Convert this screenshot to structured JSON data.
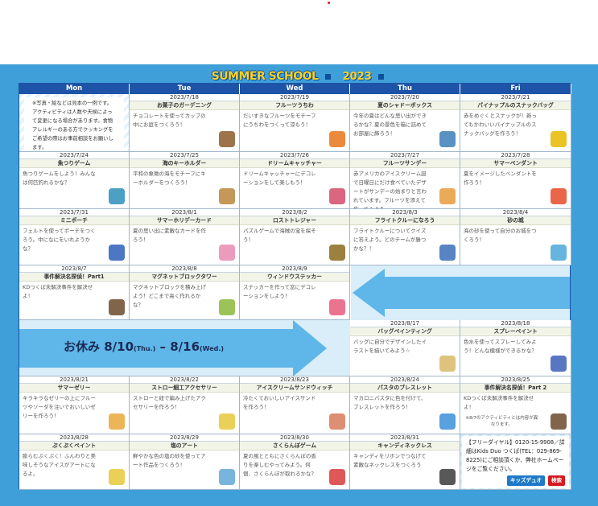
{
  "header": {
    "title": "SUMMER SCHOOL",
    "year": "2023"
  },
  "days": [
    "Mon",
    "Tue",
    "Wed",
    "Thu",
    "Fri"
  ],
  "mon_note": "※写真・絵などは見本の一例です。アクティビティは人数や天候によって変更になる場合があります。食物アレルギーのある方でクッキングをご希望の際はお事前相談をお願いします。",
  "weeks": [
    {
      "cells": [
        null,
        {
          "date": "2023/7/18",
          "title": "お菓子のガーデニング",
          "desc": "チョコレートを使ってカップの中にお庭をつくろう！",
          "icon": "cup-icon",
          "color": "#8b5a2b"
        },
        {
          "date": "2023/7/19",
          "title": "フルーツうちわ",
          "desc": "だいすきなフルーツをモチーフにうちわをつくって涼もう！",
          "icon": "fan-icon",
          "color": "#e8761a"
        },
        {
          "date": "2023/7/20",
          "title": "夏のシャドーボックス",
          "desc": "今年の夏はどんな思い出ができるかな？夏の景色を箱に詰めてお部屋に飾ろう！",
          "icon": "box-icon",
          "color": "#3b7fb8"
        },
        {
          "date": "2023/7/21",
          "title": "パイナップルのスナックバッグ",
          "desc": "赤をめぐくとスナックが！新ってもかわいいパイナップルのスナックバッグを作ろう！",
          "icon": "pineapple-icon",
          "color": "#e6b800"
        }
      ]
    },
    {
      "cells": [
        {
          "date": "2023/7/24",
          "title": "魚つりゲーム",
          "desc": "魚つりゲームをしよう！みんなは何匹釣れるかな？",
          "icon": "fish-icon",
          "color": "#2b8fb8"
        },
        {
          "date": "2023/7/25",
          "title": "海のキーホルダー",
          "desc": "平和の象徴の海をモチーフにキーホルダーをつくろう！",
          "icon": "keyholder-icon",
          "color": "#b8863b"
        },
        {
          "date": "2023/7/26",
          "title": "ドリームキャッチャー",
          "desc": "ドリームキャッチャーにデコレーションをして楽しもう！",
          "icon": "dreamcatcher-icon",
          "color": "#d44b6a"
        },
        {
          "date": "2023/7/27",
          "title": "フルーツサンデー",
          "desc": "赤アメリカのアイスクリーム誕で日曜日にだけ食べていたデザートがサンデーの始まりと言われています。フルーツを添えて作ってみよう。",
          "icon": "sundae-icon",
          "color": "#e89b3b"
        },
        {
          "date": "2023/7/28",
          "title": "サマーペンダント",
          "desc": "夏をイメージしたペンダントを作ろう！",
          "icon": "pendant-icon",
          "color": "#e84a2b"
        }
      ]
    },
    {
      "cells": [
        {
          "date": "2023/7/31",
          "title": "ミニポーチ",
          "desc": "フェルトを使ってポーチをつくろう。中になにをいれようかな？",
          "icon": "pouch-icon",
          "color": "#2b5fb8"
        },
        {
          "date": "2023/8/1",
          "title": "サマーホリデーカード",
          "desc": "夏の思い出に素敵なカードを作ろう！",
          "icon": "card-icon",
          "color": "#e88bb0"
        },
        {
          "date": "2023/8/2",
          "title": "ロストトレジャー",
          "desc": "パズルゲームで海賊の宝を探そう！",
          "icon": "treasure-icon",
          "color": "#8b6a1b"
        },
        {
          "date": "2023/8/3",
          "title": "フライトクルーになろう",
          "desc": "フライトクルーについてクイズに答えよう。どのチームが勝つかな？！",
          "icon": "crew-icon",
          "color": "#3b6fb8"
        },
        {
          "date": "2023/8/4",
          "title": "砂の城",
          "desc": "海の砂を使って自分のお城をつくろう！",
          "icon": "castle-icon",
          "color": "#4ba8d8"
        }
      ]
    },
    {
      "cells": [
        {
          "date": "2023/8/7",
          "title": "事件解決名探偵！Part1",
          "desc": "KDつくば未解決事件を解決せよ！",
          "icon": "detective-icon",
          "color": "#6b4a2b"
        },
        {
          "date": "2023/8/8",
          "title": "マグネットブロックタワー",
          "desc": "マグネットブロックを積み上げよう！どこまで高く作れるかな？",
          "icon": "block-icon",
          "color": "#8bb83b"
        },
        {
          "date": "2023/8/9",
          "title": "ウィンドウステッカー",
          "desc": "ステッカーを作って窓にデコレーションをしよう！",
          "icon": "sticker-icon",
          "color": "#e85a7a"
        },
        null,
        null
      ]
    },
    {
      "cells": [
        null,
        null,
        null,
        {
          "date": "2023/8/17",
          "title": "バッグペインティング",
          "desc": "バッグに自分でデザインしたイラストを描いてみよう☆",
          "icon": "bag-icon",
          "color": "#d8b86a"
        },
        {
          "date": "2023/8/18",
          "title": "スプレーペイント",
          "desc": "色水を使ってスプレーしてみよう！どんな模様ができるかな？",
          "icon": "spray-icon",
          "color": "#3b5fb8"
        }
      ]
    },
    {
      "cells": [
        {
          "date": "2023/8/21",
          "title": "サマーゼリー",
          "desc": "キラキラなゼリーの上にフルーツやソーダを注いでおいしいゼリーを作ろう！",
          "icon": "jelly-icon",
          "color": "#e8a83b"
        },
        {
          "date": "2023/8/22",
          "title": "ストロー細工アクセサリー",
          "desc": "ストローと紐で編み上げたアクセサリーを作ろう！",
          "icon": "straw-icon",
          "color": "#e8c83b"
        },
        {
          "date": "2023/8/23",
          "title": "アイスクリームサンドウィッチ",
          "desc": "冷たくておいしいアイスサンドを作ろう！",
          "icon": "icecream-icon",
          "color": "#d87a5a"
        },
        {
          "date": "2023/8/24",
          "title": "パスタのブレスレット",
          "desc": "マカロニパスタに色を付けて、ブレスレットを作ろう！",
          "icon": "bracelet-icon",
          "color": "#3b8fd8"
        },
        {
          "date": "2023/8/25",
          "title": "事件解決名探偵！Part 2",
          "desc": "KDつくば未解決事件を解決せよ！",
          "note": "※8/7のアクティビティとは内容が異なります。",
          "icon": "detective-icon",
          "color": "#6b4a2b"
        }
      ]
    },
    {
      "cells": [
        {
          "date": "2023/8/28",
          "title": "ぷくぷくペイント",
          "desc": "膨らむぷくぷく！ふんわりと美味しそうなアイスがアートになるよ。",
          "icon": "paint-icon",
          "color": "#e8c83b"
        },
        {
          "date": "2023/8/29",
          "title": "塩のアート",
          "desc": "鮮やかな色の塩の砂を使ってアート作品をつくろう！",
          "icon": "salt-icon",
          "color": "#5fa8d8"
        },
        {
          "date": "2023/8/30",
          "title": "さくらんぼゲーム",
          "desc": "夏の風とともにさくらんぼの香りを楽しむやってみよう。何個、さくらんぼが取れるかな？",
          "icon": "cherry-icon",
          "color": "#d83b3b"
        },
        {
          "date": "2023/8/31",
          "title": "キャンディネックレス",
          "desc": "キャンディをリボンでつなげて素敵なネックレスをつくろう",
          "icon": "necklace-icon",
          "color": "#3b3b3b"
        },
        null
      ]
    }
  ],
  "rest": {
    "label": "お休み",
    "from": "8/10",
    "from_day": "(Thu.)",
    "dash": "–",
    "to": "8/16",
    "to_day": "(Wed.)"
  },
  "info": {
    "text": "【フリーダイヤル】0120-15-9908／詳細はKids Duo つくば(TEL：029-869-8225)にご相談頂くか、弊社ホームページをご覧ください。",
    "btn1": "キッズデュオ",
    "btn2": "検索"
  }
}
